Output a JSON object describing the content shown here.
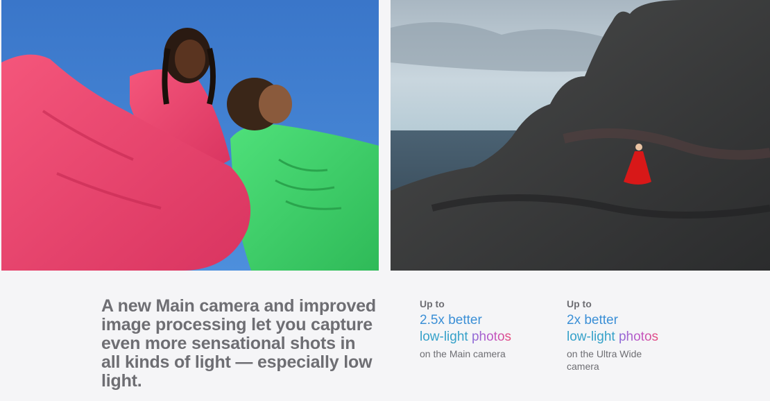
{
  "photos": {
    "left": {
      "icon": "portrait-photo",
      "colors": {
        "sky": "#3f7fd0",
        "dress_pink": "#f0466f",
        "dress_green": "#3fd76a"
      }
    },
    "right": {
      "icon": "coastal-photo",
      "colors": {
        "sky": "#b9c8d3",
        "sea": "#556a7a",
        "rock": "#3a3b3c",
        "dress_red": "#d81818"
      }
    }
  },
  "headline": "A new Main camera and improved image processing let you capture even more sensational shots in all kinds of light — especially low light.",
  "stats": [
    {
      "eyebrow": "Up to",
      "value": "2.5x better",
      "metric_word1": "low-light",
      "metric_word2": "photos",
      "caption": "on the Main camera"
    },
    {
      "eyebrow": "Up to",
      "value": "2x better",
      "metric_word1": "low-light",
      "metric_word2": "photos",
      "caption": "on the Ultra Wide camera"
    }
  ]
}
